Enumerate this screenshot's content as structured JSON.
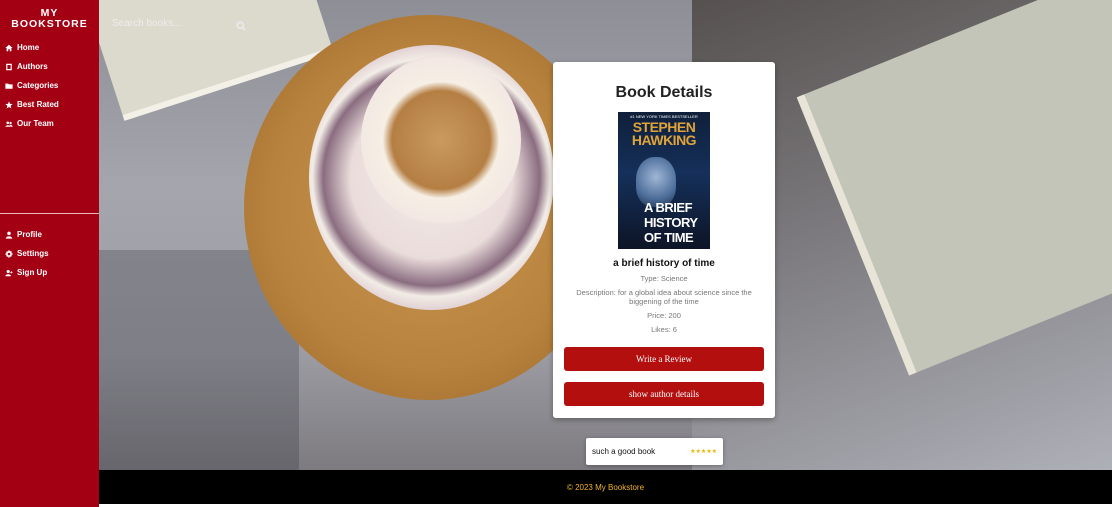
{
  "brand": {
    "line1": "MY",
    "line2": "BOOKSTORE"
  },
  "sidebar": {
    "items": [
      {
        "label": "Home",
        "icon": "home-icon"
      },
      {
        "label": "Authors",
        "icon": "book-icon"
      },
      {
        "label": "Categories",
        "icon": "folder-icon"
      },
      {
        "label": "Best Rated",
        "icon": "star-icon"
      },
      {
        "label": "Our Team",
        "icon": "users-icon"
      }
    ],
    "bottom_items": [
      {
        "label": "Profile",
        "icon": "user-icon"
      },
      {
        "label": "Settings",
        "icon": "gear-icon"
      },
      {
        "label": "Sign Up",
        "icon": "user-plus-icon"
      }
    ]
  },
  "search": {
    "placeholder": "Search books..."
  },
  "card": {
    "heading": "Book Details",
    "cover": {
      "tag": "#1 NEW YORK TIMES BESTSELLER",
      "author": "STEPHEN HAWKING",
      "title": "A BRIEF HISTORY OF TIME"
    },
    "book_title": "a brief history of time",
    "type": "Type: Science",
    "description": "Description: for a global idea about science since the biggening of the time",
    "price": "Price: 200",
    "likes": "Likes: 6",
    "write_review_label": "Write a Review",
    "author_details_label": "show author details"
  },
  "review": {
    "text": "such a good book",
    "stars": "★★★★★",
    "rating": 5
  },
  "footer": {
    "text": "© 2023 My Bookstore"
  },
  "colors": {
    "sidebar": "#a30014",
    "button": "#b30f0f",
    "footer_bg": "#000000",
    "footer_text": "#f0b429",
    "star": "#e8b500"
  }
}
